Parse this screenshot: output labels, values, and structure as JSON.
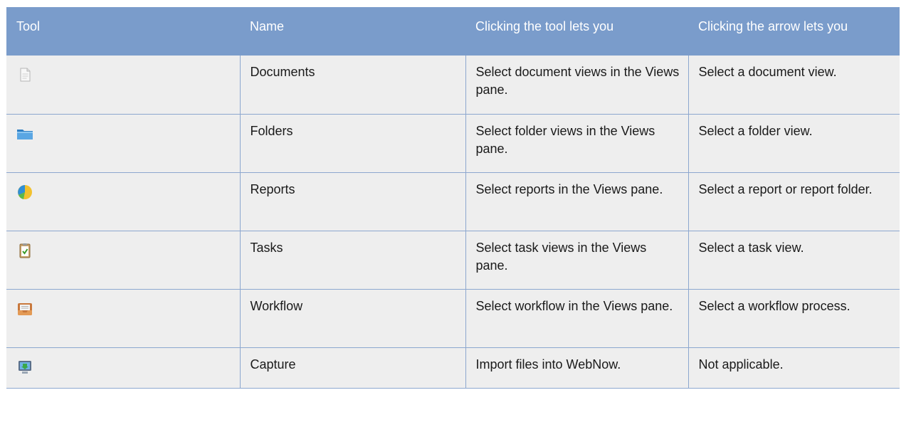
{
  "table": {
    "headers": [
      "Tool",
      "Name",
      "Clicking the tool lets you",
      "Clicking the arrow lets you"
    ],
    "rows": [
      {
        "icon": "document-icon",
        "name": "Documents",
        "tool_action": "Select document views in the Views pane.",
        "arrow_action": "Select a document view."
      },
      {
        "icon": "folder-icon",
        "name": "Folders",
        "tool_action": "Select folder views in the Views pane.",
        "arrow_action": "Select a folder view."
      },
      {
        "icon": "report-pie-icon",
        "name": "Reports",
        "tool_action": "Select reports in the Views pane.",
        "arrow_action": "Select a report or report folder."
      },
      {
        "icon": "task-clipboard-icon",
        "name": "Tasks",
        "tool_action": "Select task views in the Views pane.",
        "arrow_action": "Select a task view."
      },
      {
        "icon": "workflow-inbox-icon",
        "name": "Workflow",
        "tool_action": "Select workflow in the Views pane.",
        "arrow_action": "Select a workflow process."
      },
      {
        "icon": "capture-scanner-icon",
        "name": "Capture",
        "tool_action": "Import files into WebNow.",
        "arrow_action": "Not applicable."
      }
    ]
  }
}
